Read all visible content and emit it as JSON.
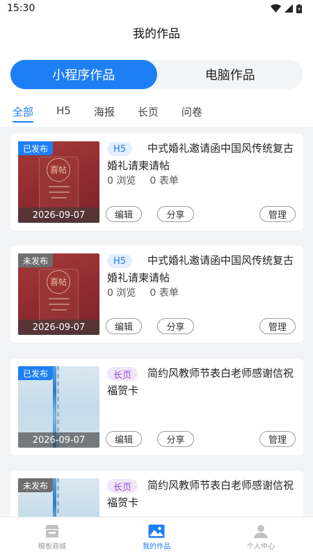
{
  "status": {
    "time": "15:30"
  },
  "header": {
    "title": "我的作品"
  },
  "segment": {
    "items": [
      "小程序作品",
      "电脑作品"
    ],
    "active": 0
  },
  "tabs": [
    "全部",
    "H5",
    "海报",
    "长页",
    "问卷"
  ],
  "cards": [
    {
      "status": "已发布",
      "status_type": "published",
      "date": "2026-09-07",
      "type": "H5",
      "title": "中式婚礼邀请函中国风传统复古婚礼请柬请帖",
      "views": "0 浏览",
      "forms": "0 表单",
      "thumb": "red",
      "thumb_text": "喜帖",
      "btn_edit": "编辑",
      "btn_share": "分享",
      "btn_manage": "管理"
    },
    {
      "status": "未发布",
      "status_type": "unpublished",
      "date": "2026-09-07",
      "type": "H5",
      "title": "中式婚礼邀请函中国风传统复古婚礼请柬请帖",
      "views": "0 浏览",
      "forms": "0 表单",
      "thumb": "red",
      "thumb_text": "喜帖",
      "btn_edit": "编辑",
      "btn_share": "分享",
      "btn_manage": "管理"
    },
    {
      "status": "已发布",
      "status_type": "published",
      "date": "2026-09-07",
      "type": "长页",
      "title": "简约风教师节表白老师感谢信祝福贺卡",
      "views": "",
      "forms": "",
      "thumb": "blue",
      "btn_edit": "编辑",
      "btn_share": "分享",
      "btn_manage": "管理"
    },
    {
      "status": "未发布",
      "status_type": "unpublished",
      "date": "",
      "type": "长页",
      "title": "简约风教师节表白老师感谢信祝福贺卡",
      "views": "",
      "forms": "",
      "thumb": "blue",
      "btn_edit": "",
      "btn_share": "",
      "btn_manage": ""
    }
  ],
  "bottom_nav": [
    {
      "label": "模板商城",
      "icon": "store-icon"
    },
    {
      "label": "我的作品",
      "icon": "image-icon",
      "active": true
    },
    {
      "label": "个人中心",
      "icon": "person-icon"
    }
  ],
  "colors": {
    "accent": "#1e7ff5",
    "unpublished": "#6e6e6e",
    "long_tag": "#9b4fd0"
  }
}
